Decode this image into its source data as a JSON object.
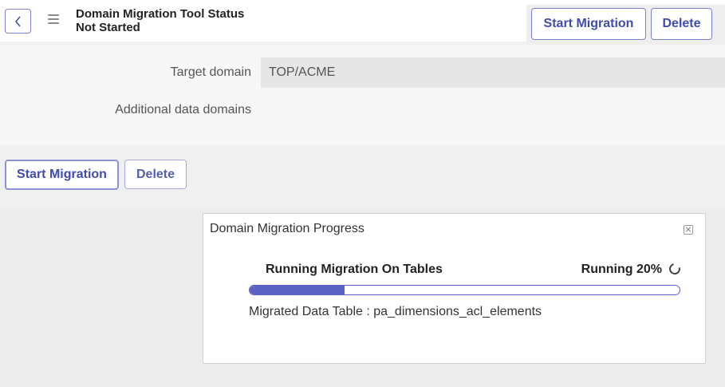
{
  "header": {
    "title_line1": "Domain Migration Tool Status",
    "title_line2": "Not Started",
    "start_label": "Start Migration",
    "delete_label": "Delete"
  },
  "form": {
    "target_domain_label": "Target domain",
    "target_domain_value": "TOP/ACME",
    "additional_domains_label": "Additional data domains"
  },
  "actions": {
    "start_label": "Start Migration",
    "delete_label": "Delete"
  },
  "dialog": {
    "title": "Domain Migration Progress",
    "progress_label": "Running Migration On Tables",
    "status_text": "Running 20%",
    "progress_fraction": 0.22,
    "detail_text": "Migrated Data Table : pa_dimensions_acl_elements"
  },
  "colors": {
    "accent": "#5b62c4",
    "button_border": "#7b80c8",
    "button_text": "#3f4baf"
  },
  "icons": [
    "chevron-left-icon",
    "hamburger-menu-icon",
    "close-icon",
    "spinner-icon"
  ]
}
